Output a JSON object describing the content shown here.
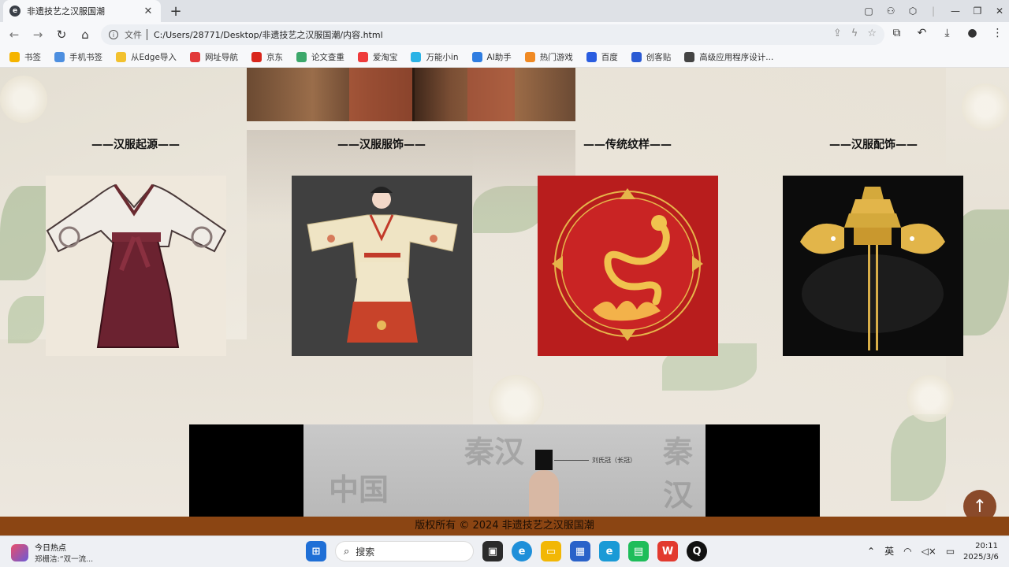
{
  "browser": {
    "tab_title": "非遗技艺之汉服国潮",
    "new_tab": "+",
    "address_label": "文件",
    "url": "C:/Users/28771/Desktop/非遗技艺之汉服国潮/内容.html",
    "bookmarks": [
      {
        "label": "书签",
        "color": "#f5b400",
        "icon": "star-icon"
      },
      {
        "label": "手机书签",
        "color": "#4d8fe0",
        "icon": "phone-icon"
      },
      {
        "label": "从Edge导入",
        "color": "#f2c12e",
        "icon": "folder-icon"
      },
      {
        "label": "网址导航",
        "color": "#e23a3a",
        "icon": "nav-icon"
      },
      {
        "label": "京东",
        "color": "#d9261c",
        "icon": "jd-icon"
      },
      {
        "label": "论文查重",
        "color": "#3da86b",
        "icon": "pp-icon"
      },
      {
        "label": "爱淘宝",
        "color": "#ef3b3b",
        "icon": "taobao-icon"
      },
      {
        "label": "万能小in",
        "color": "#2bb3e6",
        "icon": "in-icon"
      },
      {
        "label": "AI助手",
        "color": "#2f7de1",
        "icon": "ai-icon"
      },
      {
        "label": "热门游戏",
        "color": "#f08a24",
        "icon": "game-icon"
      },
      {
        "label": "百度",
        "color": "#2a5de0",
        "icon": "baidu-icon"
      },
      {
        "label": "创客贴",
        "color": "#2b5bd4",
        "icon": "chuangke-icon"
      },
      {
        "label": "高级应用程序设计...",
        "color": "#444444",
        "icon": "globe-icon"
      }
    ]
  },
  "page": {
    "columns": [
      {
        "title": "——汉服起源——",
        "image": "hanfu-origin-image"
      },
      {
        "title": "——汉服服饰——",
        "image": "hanfu-costume-image"
      },
      {
        "title": "——传统纹样——",
        "image": "traditional-pattern-image"
      },
      {
        "title": "——汉服配饰——",
        "image": "hanfu-accessory-image"
      }
    ],
    "video": {
      "chars_left": "中国",
      "chars_mid": "秦汉",
      "chars_right": "秦汉",
      "caption": "刘氏冠（长冠）"
    },
    "back_to_top": "↑",
    "footer": "版权所有 © 2024 非遗技艺之汉服国潮"
  },
  "taskbar": {
    "news_title": "今日热点",
    "news_sub": "郑栅洁:“双一流...",
    "search_placeholder": "搜索",
    "ime": "英",
    "time": "20:11",
    "date": "2025/3/6"
  }
}
